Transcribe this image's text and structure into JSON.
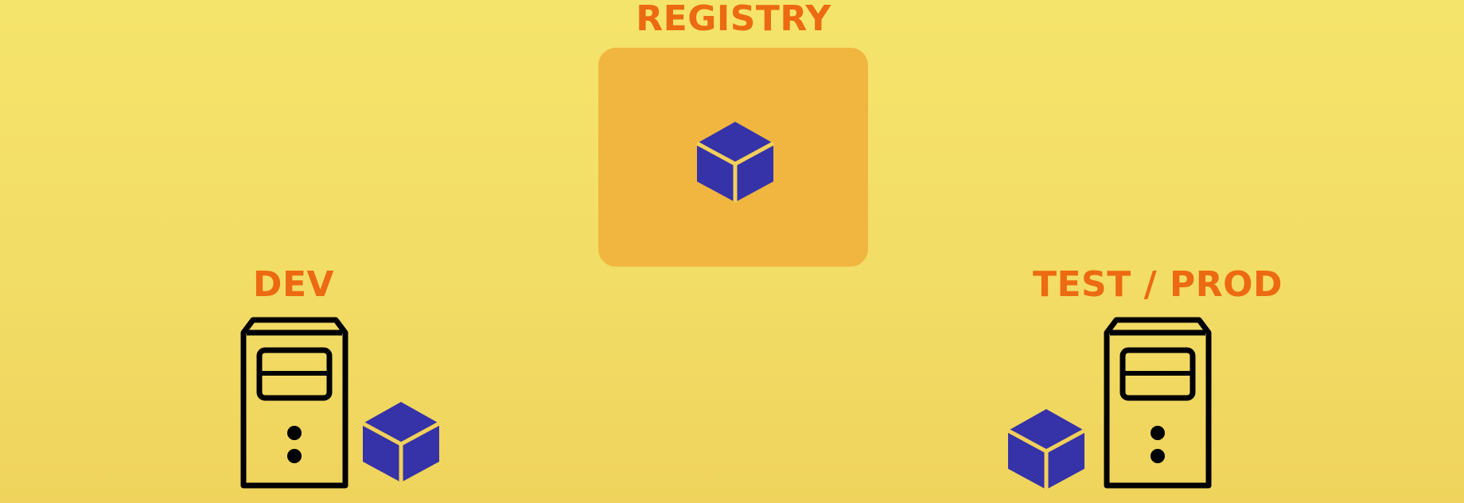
{
  "registry": {
    "label": "REGISTRY",
    "icon": "cube-icon"
  },
  "dev": {
    "label": "DEV",
    "icons": [
      "server-icon",
      "cube-icon"
    ]
  },
  "test_prod": {
    "label": "TEST / PROD",
    "icons": [
      "cube-icon",
      "server-icon"
    ]
  },
  "colors": {
    "label": "#ec6a12",
    "registry_box": "#f0b640",
    "cube": "#3632a8",
    "cube_edges": "#f2d05a",
    "server": "#000000"
  }
}
